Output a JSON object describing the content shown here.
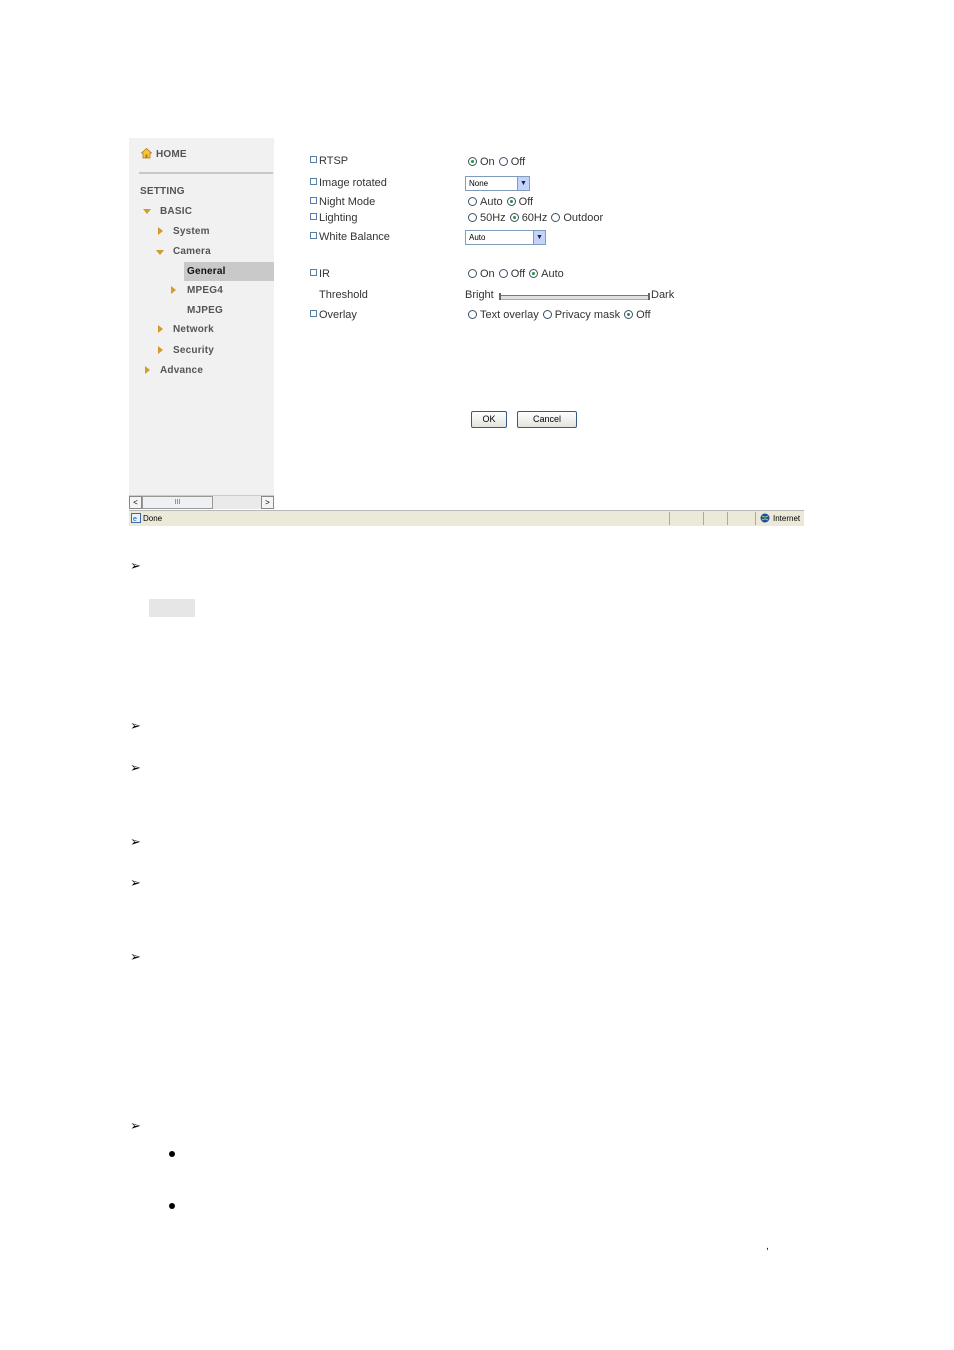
{
  "sidebar": {
    "home": "HOME",
    "setting": "SETTING",
    "basic": "BASIC",
    "system": "System",
    "camera": "Camera",
    "general": "General",
    "mpeg4": "MPEG4",
    "mjpeg": "MJPEG",
    "network": "Network",
    "security": "Security",
    "advance": "Advance"
  },
  "form": {
    "rtsp": {
      "label": "RTSP",
      "on": "On",
      "off": "Off",
      "selected": "On"
    },
    "image_rotated": {
      "label": "Image rotated",
      "value": "None"
    },
    "night_mode": {
      "label": "Night Mode",
      "auto": "Auto",
      "off": "Off",
      "selected": "Off"
    },
    "lighting": {
      "label": "Lighting",
      "hz50": "50Hz",
      "hz60": "60Hz",
      "outdoor": "Outdoor",
      "selected": "60Hz"
    },
    "white_balance": {
      "label": "White Balance",
      "value": "Auto"
    },
    "ir": {
      "label": "IR",
      "on": "On",
      "off": "Off",
      "auto": "Auto",
      "selected": "Auto"
    },
    "threshold": {
      "label": "Threshold",
      "left": "Bright",
      "right": "Dark"
    },
    "overlay": {
      "label": "Overlay",
      "text": "Text overlay",
      "privacy": "Privacy mask",
      "off": "Off",
      "selected": "Off"
    },
    "ok": "OK",
    "cancel": "Cancel"
  },
  "scrollbar": {
    "thumb": "III",
    "left": "<",
    "right": ">"
  },
  "statusbar": {
    "status": "Done",
    "zone": "Internet"
  },
  "doc": {
    "comma": ","
  }
}
